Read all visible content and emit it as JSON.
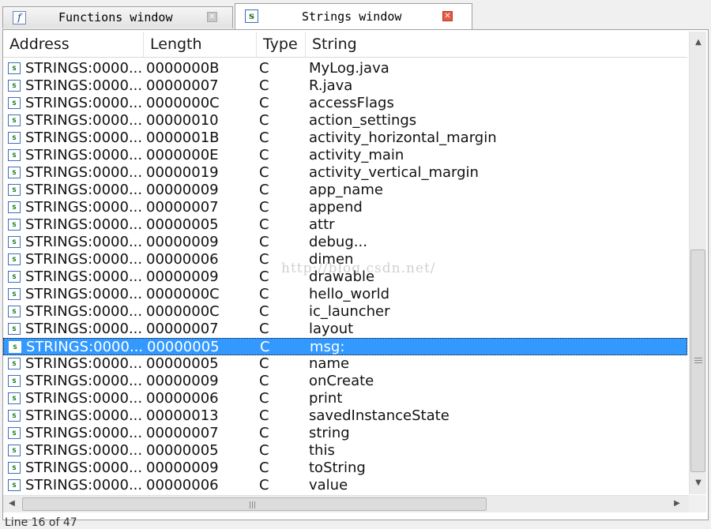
{
  "tabs": [
    {
      "label": "Functions window",
      "icon": "function-icon",
      "icon_glyph": "f",
      "close_glyph": "✕",
      "active": false
    },
    {
      "label": "Strings window",
      "icon": "string-icon",
      "icon_glyph": "s",
      "close_glyph": "✕",
      "active": true
    }
  ],
  "table": {
    "columns": [
      "Address",
      "Length",
      "Type",
      "String"
    ],
    "row_icon": "string-item-icon",
    "row_icon_glyph": "s",
    "rows": [
      {
        "address": "STRINGS:0000...",
        "length": "0000000B",
        "type": "C",
        "string": "MyLog.java"
      },
      {
        "address": "STRINGS:0000...",
        "length": "00000007",
        "type": "C",
        "string": "R.java"
      },
      {
        "address": "STRINGS:0000...",
        "length": "0000000C",
        "type": "C",
        "string": "accessFlags"
      },
      {
        "address": "STRINGS:0000...",
        "length": "00000010",
        "type": "C",
        "string": "action_settings"
      },
      {
        "address": "STRINGS:0000...",
        "length": "0000001B",
        "type": "C",
        "string": "activity_horizontal_margin"
      },
      {
        "address": "STRINGS:0000...",
        "length": "0000000E",
        "type": "C",
        "string": "activity_main"
      },
      {
        "address": "STRINGS:0000...",
        "length": "00000019",
        "type": "C",
        "string": "activity_vertical_margin"
      },
      {
        "address": "STRINGS:0000...",
        "length": "00000009",
        "type": "C",
        "string": "app_name"
      },
      {
        "address": "STRINGS:0000...",
        "length": "00000007",
        "type": "C",
        "string": "append"
      },
      {
        "address": "STRINGS:0000...",
        "length": "00000005",
        "type": "C",
        "string": "attr"
      },
      {
        "address": "STRINGS:0000...",
        "length": "00000009",
        "type": "C",
        "string": "debug..."
      },
      {
        "address": "STRINGS:0000...",
        "length": "00000006",
        "type": "C",
        "string": "dimen"
      },
      {
        "address": "STRINGS:0000...",
        "length": "00000009",
        "type": "C",
        "string": "drawable"
      },
      {
        "address": "STRINGS:0000...",
        "length": "0000000C",
        "type": "C",
        "string": "hello_world"
      },
      {
        "address": "STRINGS:0000...",
        "length": "0000000C",
        "type": "C",
        "string": "ic_launcher"
      },
      {
        "address": "STRINGS:0000...",
        "length": "00000007",
        "type": "C",
        "string": "layout"
      },
      {
        "address": "STRINGS:0000...",
        "length": "00000005",
        "type": "C",
        "string": "msg:",
        "selected": true
      },
      {
        "address": "STRINGS:0000...",
        "length": "00000005",
        "type": "C",
        "string": "name"
      },
      {
        "address": "STRINGS:0000...",
        "length": "00000009",
        "type": "C",
        "string": "onCreate"
      },
      {
        "address": "STRINGS:0000...",
        "length": "00000006",
        "type": "C",
        "string": "print"
      },
      {
        "address": "STRINGS:0000...",
        "length": "00000013",
        "type": "C",
        "string": "savedInstanceState"
      },
      {
        "address": "STRINGS:0000...",
        "length": "00000007",
        "type": "C",
        "string": "string"
      },
      {
        "address": "STRINGS:0000...",
        "length": "00000005",
        "type": "C",
        "string": "this"
      },
      {
        "address": "STRINGS:0000...",
        "length": "00000009",
        "type": "C",
        "string": "toString"
      },
      {
        "address": "STRINGS:0000...",
        "length": "00000006",
        "type": "C",
        "string": "value"
      }
    ]
  },
  "scrollbars": {
    "vertical": {
      "up_glyph": "▲",
      "down_glyph": "▼",
      "position_fraction": 0.62
    },
    "horizontal": {
      "left_glyph": "◀",
      "right_glyph": "▶",
      "position_fraction": 0.0
    }
  },
  "status_text": "Line 16 of 47",
  "watermark": "http://blog.csdn.net/",
  "colors": {
    "selection": "#3399ff",
    "close_active": "#e95842"
  }
}
